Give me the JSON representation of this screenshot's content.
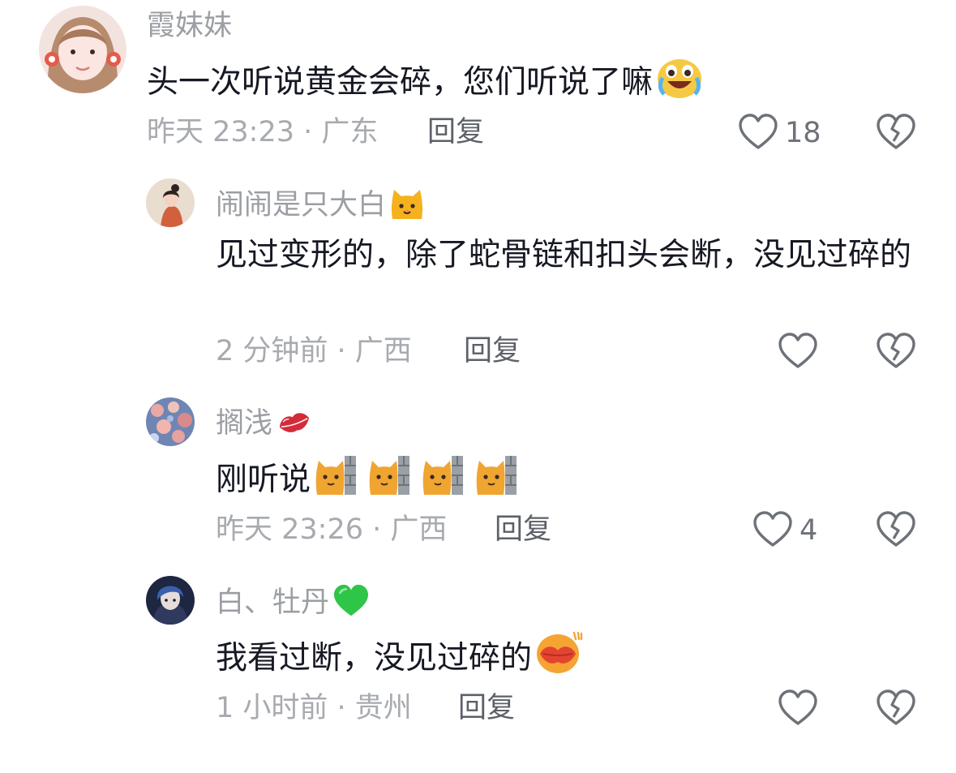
{
  "comments": [
    {
      "user": "霞妹妹",
      "text": "头一次听说黄金会碎，您们听说了嘛",
      "time": "昨天 23:23 · 广东",
      "reply_label": "回复",
      "likes": "18"
    },
    {
      "user": "闹闹是只大白",
      "text": "见过变形的，除了蛇骨链和扣头会断，没见过碎的",
      "time": "2 分钟前 · 广西",
      "reply_label": "回复",
      "likes": ""
    },
    {
      "user": "搁浅",
      "text": "刚听说",
      "time": "昨天 23:26 · 广西",
      "reply_label": "回复",
      "likes": "4"
    },
    {
      "user": "白、牡丹",
      "text": "我看过断，没见过碎的",
      "time": "1 小时前 · 贵州",
      "reply_label": "回复",
      "likes": ""
    }
  ],
  "icons": {
    "like": "heart-outline-icon",
    "dislike": "broken-heart-icon"
  },
  "colors": {
    "name": "#9b9ea3",
    "text": "#161823",
    "meta": "#a7aaaf",
    "reply": "#5c6068",
    "icon": "#6d7178"
  }
}
